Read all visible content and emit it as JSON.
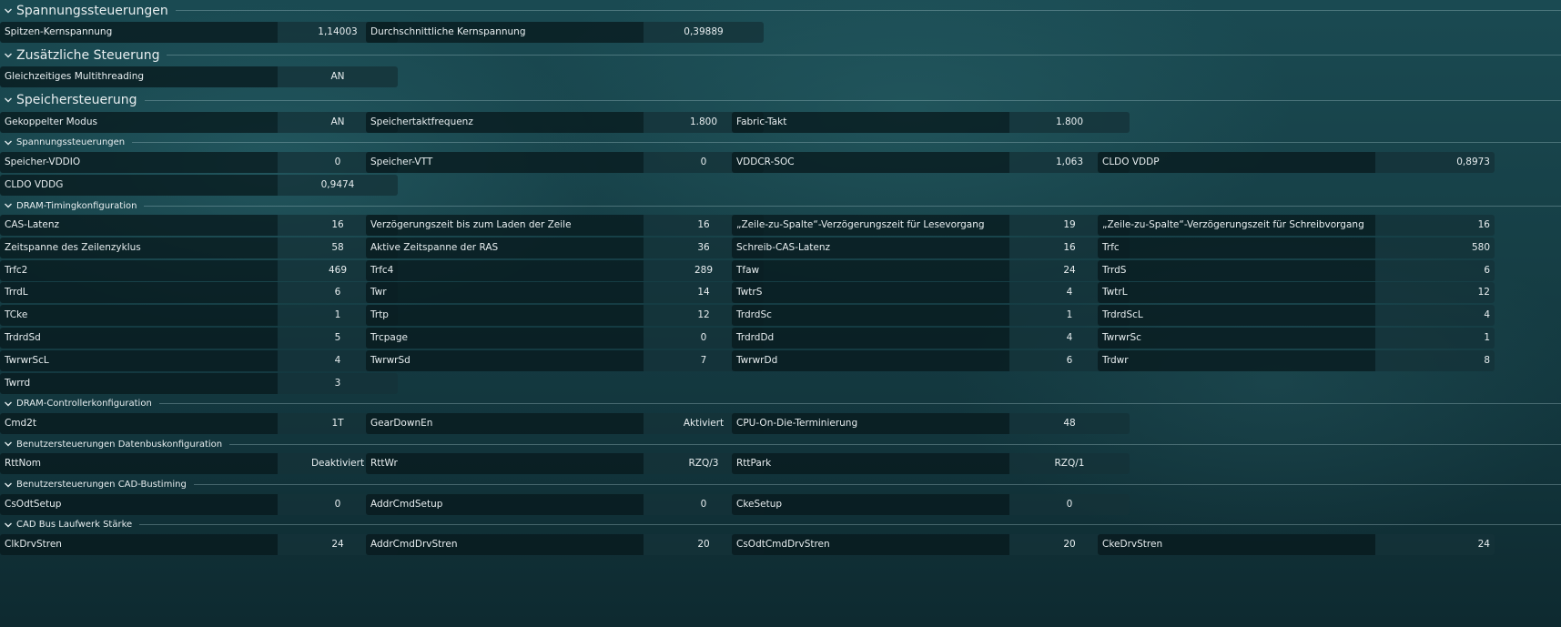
{
  "sections": [
    {
      "title": "Spannungssteuerungen",
      "size": "big",
      "rows": [
        [
          {
            "label": "Spitzen-Kernspannung",
            "value": "1,14003"
          },
          {
            "label": "Durchschnittliche Kernspannung",
            "value": "0,39889"
          }
        ]
      ]
    },
    {
      "title": "Zusätzliche Steuerung",
      "size": "big",
      "rows": [
        [
          {
            "label": "Gleichzeitiges Multithreading",
            "value": "AN"
          }
        ]
      ]
    },
    {
      "title": "Speichersteuerung",
      "size": "big",
      "rows": [
        [
          {
            "label": "Gekoppelter Modus",
            "value": "AN"
          },
          {
            "label": "Speichertaktfrequenz",
            "value": "1.800"
          },
          {
            "label": "Fabric-Takt",
            "value": "1.800"
          }
        ]
      ]
    },
    {
      "title": "Spannungssteuerungen",
      "size": "small",
      "rows": [
        [
          {
            "label": "Speicher-VDDIO",
            "value": "0"
          },
          {
            "label": "Speicher-VTT",
            "value": "0"
          },
          {
            "label": "VDDCR-SOC",
            "value": "1,063"
          },
          {
            "label": "CLDO VDDP",
            "value": "0,8973"
          }
        ],
        [
          {
            "label": "CLDO VDDG",
            "value": "0,9474"
          }
        ]
      ]
    },
    {
      "title": "DRAM-Timingkonfiguration",
      "size": "small",
      "rows": [
        [
          {
            "label": "CAS-Latenz",
            "value": "16"
          },
          {
            "label": "Verzögerungszeit bis zum Laden der Zeile",
            "value": "16"
          },
          {
            "label": "„Zeile-zu-Spalte“-Verzögerungszeit für Lesevorgang",
            "value": "19"
          },
          {
            "label": "„Zeile-zu-Spalte“-Verzögerungszeit für Schreibvorgang",
            "value": "16"
          }
        ],
        [
          {
            "label": "Zeitspanne des Zeilenzyklus",
            "value": "58"
          },
          {
            "label": "Aktive Zeitspanne der RAS",
            "value": "36"
          },
          {
            "label": "Schreib-CAS-Latenz",
            "value": "16"
          },
          {
            "label": "Trfc",
            "value": "580"
          }
        ],
        [
          {
            "label": "Trfc2",
            "value": "469"
          },
          {
            "label": "Trfc4",
            "value": "289"
          },
          {
            "label": "Tfaw",
            "value": "24"
          },
          {
            "label": "TrrdS",
            "value": "6"
          }
        ],
        [
          {
            "label": "TrrdL",
            "value": "6"
          },
          {
            "label": "Twr",
            "value": "14"
          },
          {
            "label": "TwtrS",
            "value": "4"
          },
          {
            "label": "TwtrL",
            "value": "12"
          }
        ],
        [
          {
            "label": "TCke",
            "value": "1"
          },
          {
            "label": "Trtp",
            "value": "12"
          },
          {
            "label": "TrdrdSc",
            "value": "1"
          },
          {
            "label": "TrdrdScL",
            "value": "4"
          }
        ],
        [
          {
            "label": "TrdrdSd",
            "value": "5"
          },
          {
            "label": "Trcpage",
            "value": "0"
          },
          {
            "label": "TrdrdDd",
            "value": "4"
          },
          {
            "label": "TwrwrSc",
            "value": "1"
          }
        ],
        [
          {
            "label": "TwrwrScL",
            "value": "4"
          },
          {
            "label": "TwrwrSd",
            "value": "7"
          },
          {
            "label": "TwrwrDd",
            "value": "6"
          },
          {
            "label": "Trdwr",
            "value": "8"
          }
        ],
        [
          {
            "label": "Twrrd",
            "value": "3"
          }
        ]
      ]
    },
    {
      "title": "DRAM-Controllerkonfiguration",
      "size": "small",
      "rows": [
        [
          {
            "label": "Cmd2t",
            "value": "1T"
          },
          {
            "label": "GearDownEn",
            "value": "Aktiviert"
          },
          {
            "label": "CPU-On-Die-Terminierung",
            "value": "48"
          }
        ]
      ]
    },
    {
      "title": "Benutzersteuerungen Datenbuskonfiguration",
      "size": "small",
      "rows": [
        [
          {
            "label": "RttNom",
            "value": "Deaktiviert"
          },
          {
            "label": "RttWr",
            "value": "RZQ/3"
          },
          {
            "label": "RttPark",
            "value": "RZQ/1"
          }
        ]
      ]
    },
    {
      "title": "Benutzersteuerungen CAD-Bustiming",
      "size": "small",
      "rows": [
        [
          {
            "label": "CsOdtSetup",
            "value": "0"
          },
          {
            "label": "AddrCmdSetup",
            "value": "0"
          },
          {
            "label": "CkeSetup",
            "value": "0"
          }
        ]
      ]
    },
    {
      "title": "CAD Bus Laufwerk Stärke",
      "size": "small",
      "rows": [
        [
          {
            "label": "ClkDrvStren",
            "value": "24"
          },
          {
            "label": "AddrCmdDrvStren",
            "value": "20"
          },
          {
            "label": "CsOdtCmdDrvStren",
            "value": "20"
          },
          {
            "label": "CkeDrvStren",
            "value": "24"
          }
        ]
      ]
    }
  ]
}
